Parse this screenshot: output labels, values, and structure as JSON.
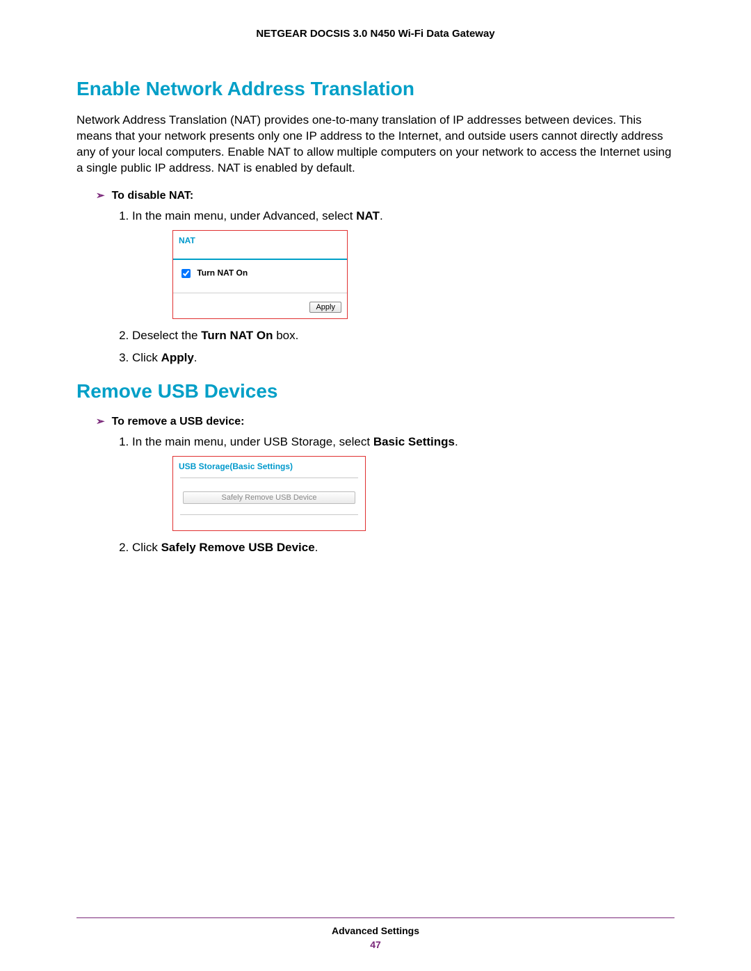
{
  "header": {
    "title": "NETGEAR DOCSIS 3.0 N450 Wi-Fi Data Gateway"
  },
  "section1": {
    "heading": "Enable Network Address Translation",
    "para": "Network Address Translation (NAT) provides one-to-many translation of IP addresses between devices. This means that your network presents only one IP address to the Internet, and outside users cannot directly address any of your local computers. Enable NAT to allow multiple computers on your network to access the Internet using a single public IP address. NAT is enabled by default.",
    "procTitle": "To disable NAT:",
    "step1_pre": "In the main menu, under Advanced, select ",
    "step1_bold": "NAT",
    "step1_post": ".",
    "nat_title": "NAT",
    "nat_checkbox_label": "Turn NAT On",
    "nat_apply": "Apply",
    "step2_pre": "Deselect the ",
    "step2_bold": "Turn NAT On",
    "step2_post": " box.",
    "step3_pre": "Click ",
    "step3_bold": "Apply",
    "step3_post": "."
  },
  "section2": {
    "heading": "Remove USB Devices",
    "procTitle": "To remove a USB device:",
    "step1_pre": "In the main menu, under USB Storage, select ",
    "step1_bold": "Basic Settings",
    "step1_post": ".",
    "usb_title": "USB Storage(Basic Settings)",
    "usb_button": "Safely Remove USB Device",
    "step2_pre": "Click ",
    "step2_bold": "Safely Remove USB Device",
    "step2_post": "."
  },
  "footer": {
    "section": "Advanced Settings",
    "page": "47"
  }
}
